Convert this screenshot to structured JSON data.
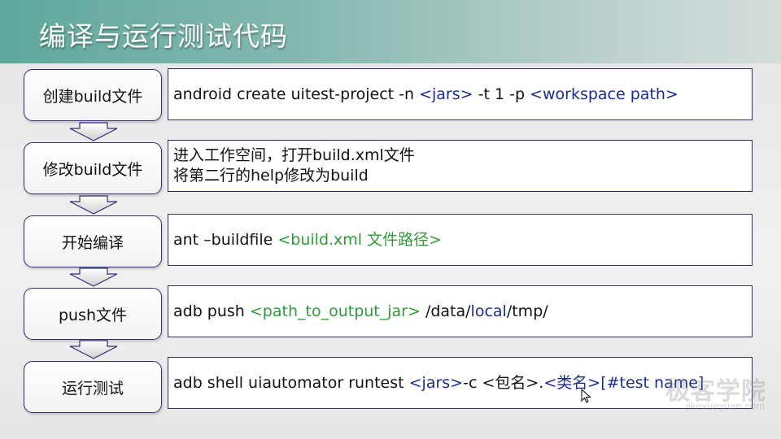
{
  "title": "编译与运行测试代码",
  "steps": [
    {
      "label": "创建build文件",
      "lines": [
        [
          {
            "t": "android create uitest-project -n ",
            "c": "default"
          },
          {
            "t": "<jars>",
            "c": "navy"
          },
          {
            "t": " -t 1 -p ",
            "c": "default"
          },
          {
            "t": "<workspace path>",
            "c": "navy"
          }
        ]
      ]
    },
    {
      "label": "修改build文件",
      "lines": [
        [
          {
            "t": "进入工作空间，打开build.xml文件",
            "c": "default"
          }
        ],
        [
          {
            "t": "将第二行的help修改为build",
            "c": "default"
          }
        ]
      ]
    },
    {
      "label": "开始编译",
      "lines": [
        [
          {
            "t": "ant –buildfile ",
            "c": "default"
          },
          {
            "t": "<build.xml 文件路径>",
            "c": "green"
          }
        ]
      ]
    },
    {
      "label": "push文件",
      "lines": [
        [
          {
            "t": "adb push ",
            "c": "default"
          },
          {
            "t": "<path_to_output_jar>",
            "c": "green"
          },
          {
            "t": " /data/",
            "c": "default"
          },
          {
            "t": "local",
            "c": "navy"
          },
          {
            "t": "/tmp/",
            "c": "default"
          }
        ]
      ]
    },
    {
      "label": "运行测试",
      "lines": [
        [
          {
            "t": "adb shell uiautomator runtest ",
            "c": "default"
          },
          {
            "t": "<jars>",
            "c": "navy"
          },
          {
            "t": "-c <包名>.",
            "c": "default"
          },
          {
            "t": "<类名>",
            "c": "navy"
          },
          {
            "t": "[#test name]",
            "c": "navy"
          }
        ]
      ]
    }
  ],
  "watermark": {
    "main": "极客学院",
    "sub": "jikexueyuan.com"
  },
  "colors": {
    "green": "#2f9a3a",
    "navy": "#1a2b8c",
    "border": "#2f2f6f",
    "accent_band": "#5fa89c"
  }
}
